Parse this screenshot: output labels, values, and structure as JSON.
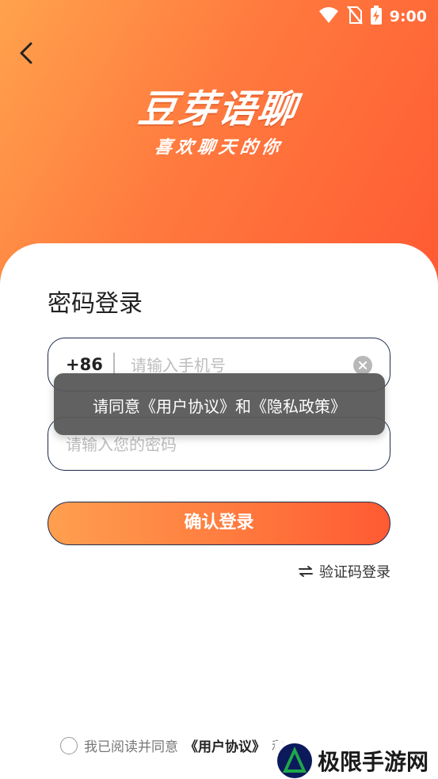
{
  "status_bar": {
    "time": "9:00"
  },
  "brand": {
    "name": "豆芽语聊",
    "slogan": "喜欢聊天的你"
  },
  "page": {
    "title": "密码登录"
  },
  "phone_field": {
    "country_code": "+86",
    "placeholder": "请输入手机号"
  },
  "password_field": {
    "placeholder": "请输入您的密码"
  },
  "toast": {
    "message": "请同意《用户协议》和《隐私政策》"
  },
  "login_button": {
    "label": "确认登录"
  },
  "switch_login": {
    "label": "验证码登录"
  },
  "agreement": {
    "prefix": "我已阅读并同意",
    "user_agreement": "《用户协议》",
    "conjunction": "和"
  },
  "watermark": {
    "text": "极限手游网"
  },
  "colors": {
    "accent_start": "#ffa24d",
    "accent_end": "#ff5a33",
    "border": "#1d2b4f"
  }
}
